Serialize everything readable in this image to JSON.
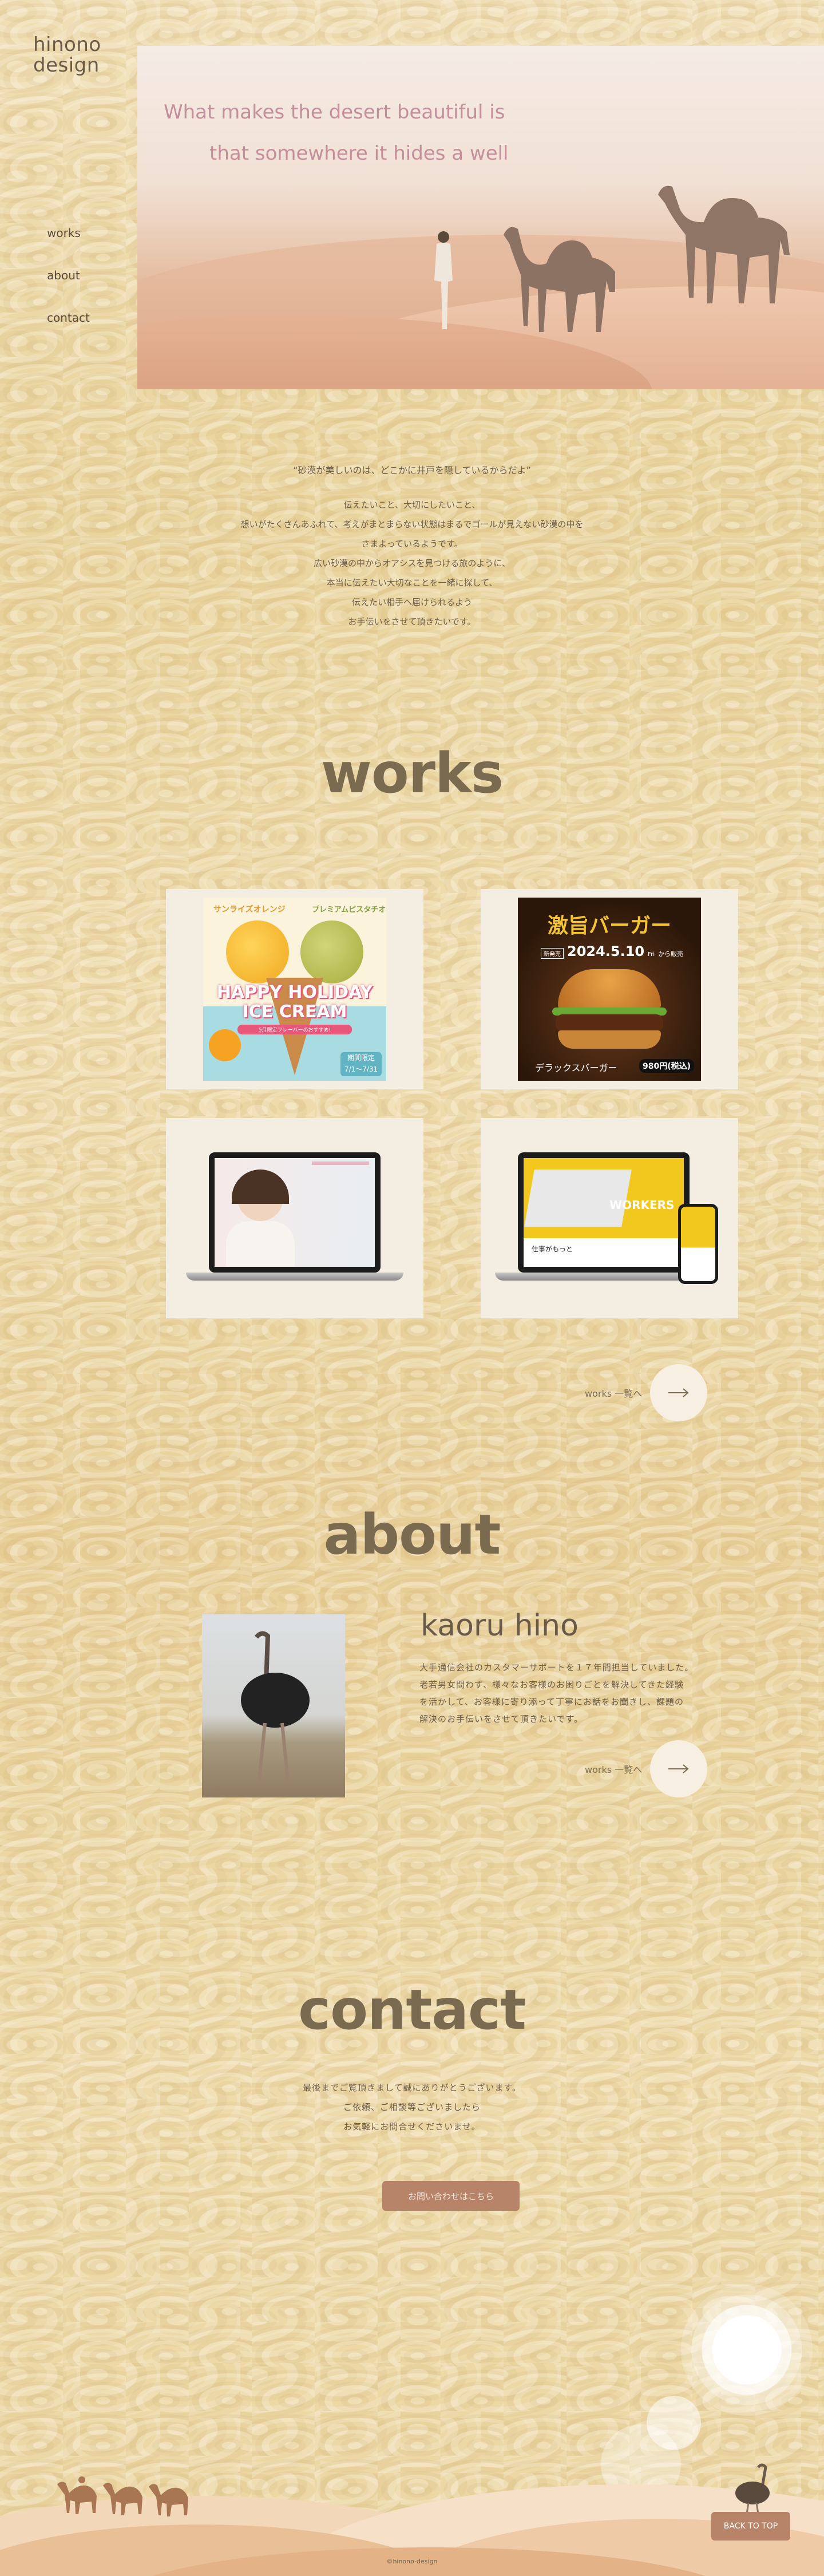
{
  "logo": {
    "line1": "hinono",
    "line2": "design"
  },
  "nav": {
    "items": [
      "works",
      "about",
      "contact"
    ]
  },
  "hero": {
    "line1": "What makes the desert beautiful is",
    "line2": "that somewhere it hides a well"
  },
  "intro": {
    "quote": "“砂漠が美しいのは、どこかに井戸を隠しているからだよ”",
    "lines": [
      "伝えたいこと、大切にしたいこと、",
      "想いがたくさんあふれて、考えがまとまらない状態はまるでゴールが見えない砂漠の中を",
      "さまよっているようです。",
      "広い砂漠の中からオアシスを見つける旅のように、",
      "本当に伝えたい大切なことを一緒に探して、",
      "伝えたい相手へ届けられるよう",
      "お手伝いをさせて頂きたいです。"
    ]
  },
  "works": {
    "title": "works",
    "more_label": "works 一覧へ",
    "cards": [
      {
        "name": "ice-cream",
        "top_left": "サンライズオレンジ",
        "top_right": "プレミアムピスタチオ",
        "headline1": "HAPPY HOLIDAY",
        "headline2": "ICE CREAM",
        "sub": "5月限定フレーバーのおすすめ!",
        "badge1": "期間限定",
        "badge2": "7/1～7/31"
      },
      {
        "name": "burger",
        "title": "激旨バーガー",
        "tag": "新発売",
        "date": "2024.5.10",
        "day": "Fri",
        "suffix": "から販売",
        "product": "デラックスバーガー",
        "price": "980円(税込)"
      },
      {
        "name": "laptop-portrait",
        "label": ""
      },
      {
        "name": "laptop-workers",
        "brand": "WORKERS",
        "caption": "仕事がもっと"
      }
    ]
  },
  "about": {
    "title": "about",
    "name": "kaoru hino",
    "lines": [
      "大手通信会社のカスタマーサポートを１７年間担当していました。",
      "老若男女問わず、様々なお客様のお困りごとを解決してきた経験",
      "を活かして、お客様に寄り添って丁寧にお話をお聞きし、課題の",
      "解決のお手伝いをさせて頂きたいです。"
    ],
    "more_label": "works 一覧へ"
  },
  "contact": {
    "title": "contact",
    "lines": [
      "最後までご覧頂きまして誠にありがとうございます。",
      "ご依頼、ご相談等ございましたら",
      "お気軽にお問合せくださいませ。"
    ],
    "button_label": "お問い合わせはこちら"
  },
  "footer": {
    "back_to_top": "BACK TO TOP",
    "copyright": "©hinono-design"
  },
  "colors": {
    "accent": "#b7846a",
    "heading": "#7a6a4f",
    "hero_text": "#c48f9c",
    "card_bg": "#f4ede1"
  }
}
